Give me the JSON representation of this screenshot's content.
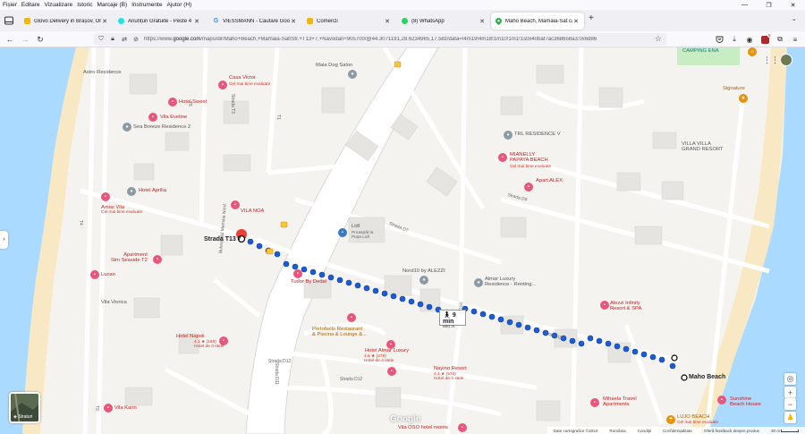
{
  "menubar": {
    "items": [
      "Fișier",
      "Editare",
      "Vizualizare",
      "Istoric",
      "Marcaje (B)",
      "Instrumente",
      "Ajutor (H)"
    ]
  },
  "window_controls": {
    "minimize": "—",
    "maximize": "❐",
    "close": "✕"
  },
  "tabs": [
    {
      "title": "Glovo Delivery in Brașov, Order Fo",
      "favicon_color": "#f2b705",
      "active": false
    },
    {
      "title": "Anunțuri Gratuite - Peste 4 milio",
      "favicon_color": "#23e5db",
      "active": false
    },
    {
      "title": "VIESSMANN - Căutare Google",
      "favicon_color": "#4285f4",
      "active": false
    },
    {
      "title": "Comenzi",
      "favicon_color": "#f2b705",
      "active": false
    },
    {
      "title": "(8) WhatsApp",
      "favicon_color": "#25d366",
      "active": false
    },
    {
      "title": "Maho Beach, Mamaia-Sat către Str",
      "favicon_color": "#34a853",
      "active": true
    }
  ],
  "new_tab": "+",
  "navbar": {
    "url_prefix": "https://www.",
    "url_domain": "google.com",
    "url_rest": "/maps/dir/Maho+Beach,+Mamaia-Sat/Str.+T13+7,+Năvodari+905700/@44.3071191,28.6234965,17.58z/data=!4m19!4m18!1m10!1m1!1s0x40baf7ac368658a3:0x6d86",
    "extension_badge": "9"
  },
  "map": {
    "start_label": "Strada T13 7",
    "end_label": "Maho Beach",
    "walk_time": "9 min",
    "walk_distance": "650 m",
    "layers_label": "Straturi",
    "google_logo": "Google",
    "footer": [
      "Date cartografice ©2024",
      "România",
      "Condiții",
      "Confidențialitate",
      "Oferă feedback despre produs",
      "30 m"
    ],
    "places": {
      "camping_ena": "CAMPING ENA",
      "maia_dog_salon": "Maia Dog Salon",
      "astro_residence": "Astro Residence",
      "casa_victor": "Casa Victor",
      "casa_victor_sub": "Cel mai bine evaluate",
      "hotel_sweet": "Hotel Sweet",
      "vila_eveline": "Vila Eveline",
      "sea_breeze": "Sea Breeze Residence 2",
      "signature": "Signature",
      "trl_residence": "TRL RESIDENCE V",
      "vila_villa_grand": "VILLA VILLA\nGRAND RESORT",
      "mianelly": "MIANELLY\nPAPAYA BEACH",
      "mianelly_sub": "Cel mai bine evaluate",
      "apart_alex": "Apart ALEX",
      "hotel_aprilia": "Hotel Aprilia",
      "amos_vila": "Amos Vila",
      "amos_vila_sub": "Cel mai bine evaluate",
      "vila_noa": "VILA NOA",
      "lidl": "Lidl",
      "lidl_sub": "Proaspăt la\nPiața Lidl",
      "apartment_sim": "Apartment\nSim Seaside T2",
      "lucan": "Lucan",
      "tudor": "Tudor By Dedal",
      "nord10": "Nord10 by ALEZZI",
      "almar_luxury_res": "Almar Luxury\nResidence - Renting...",
      "alezzi_infinity": "Alezzi Infinity\nResort & SPA",
      "vila_viorica": "Vila Viorica",
      "hotel_napoli": "Hotel Napoli",
      "hotel_napoli_sub": "4.1 ★ (168)\nHotel de 3 stele",
      "portobello": "Portobello Restaurant\n& Piscina & Lounge &...",
      "hotel_almar": "Hotel Almar Luxury",
      "hotel_almar_sub": "4.6 ★ (279)\nHotel de 4 stele",
      "nayino": "Nayino Resort",
      "nayino_sub": "4.4 ★ (572)\nHotel de 4 stele",
      "mihaela": "Mihaela Travel\nApartments",
      "sunshine": "Sunshine\nBeach House",
      "lujo": "LUJO BEACH",
      "lujo_sub": "Cel mai bine evaluate",
      "vila_karin": "Vila Karin",
      "vila_oso": "Vila OSO hotel rooms",
      "bd_mamaia": "Bulevardul Mamaia Nord"
    },
    "streets": {
      "t3": "Strada T3",
      "t4": "T4",
      "t1": "T1",
      "t5": "T5",
      "d7": "Strada D7",
      "d8": "Strada D8",
      "d9": "Strada D9",
      "d10": "Strada D10",
      "d11": "Strada D11",
      "d12a": "Strada D12",
      "d12b": "Strada D12",
      "t9": "T9"
    }
  }
}
